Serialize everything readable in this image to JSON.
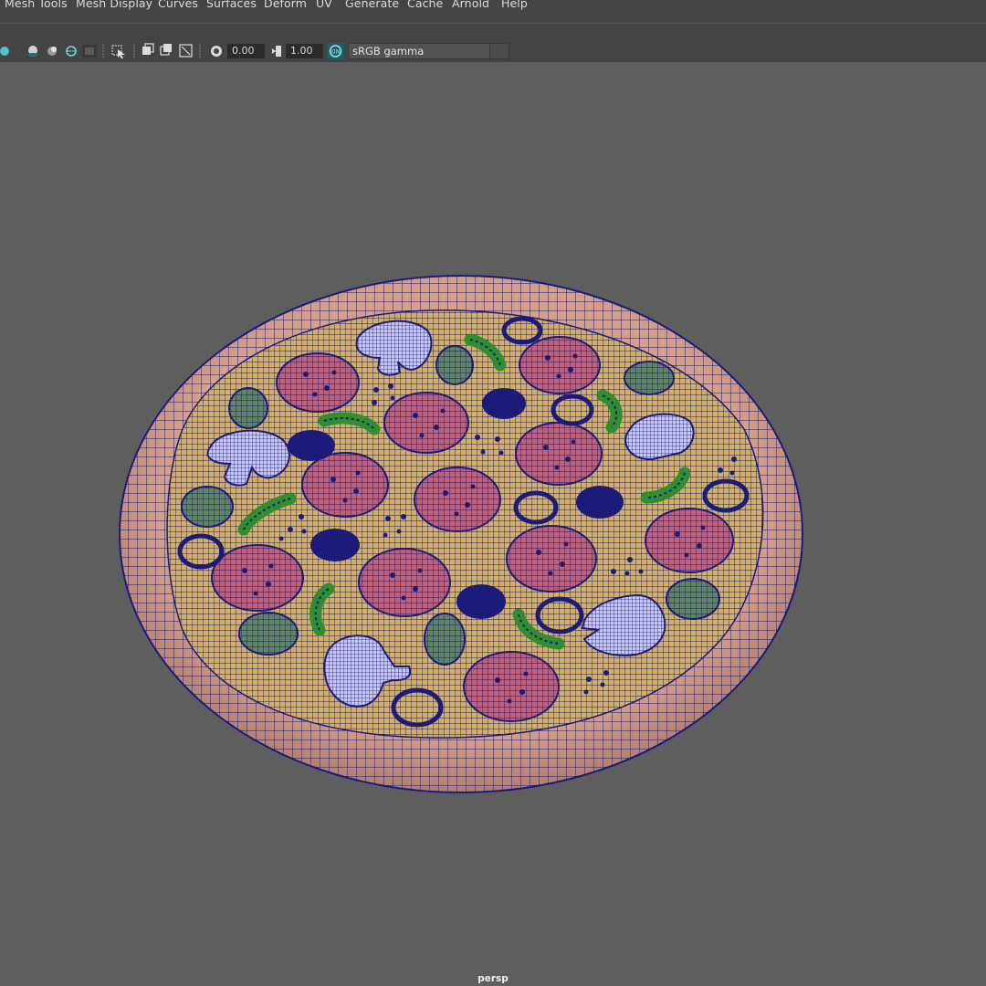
{
  "menu": {
    "items": [
      "Mesh Tools",
      "Mesh Display",
      "Curves",
      "Surfaces",
      "Deform",
      "UV",
      "Generate",
      "Cache",
      "Arnold",
      "Help"
    ]
  },
  "toolbar": {
    "exposure_value": "0.00",
    "gamma_value": "1.00",
    "color_space": "sRGB gamma",
    "icons": [
      "isolate-sphere-icon",
      "shaded-sphere-icon",
      "lit-sphere-icon",
      "wire-sphere-icon",
      "grid-square-icon",
      "select-camera-icon",
      "film-gate-icon",
      "resolution-gate-icon",
      "safe-action-icon",
      "field-chart-icon",
      "exposure-icon",
      "gamma-icon",
      "color-management-icon"
    ]
  },
  "viewport": {
    "camera": "persp",
    "background_color": "#5e5e5e",
    "wire_color": "#1c1b7a",
    "crust_color": "#d79f83",
    "cheese_color": "#d9b04a",
    "pepperoni_color": "#cf5b63",
    "olive_color": "#5c8a4c",
    "pepper_color": "#3aa03a",
    "mushroom_color": "#c8c8e6"
  }
}
